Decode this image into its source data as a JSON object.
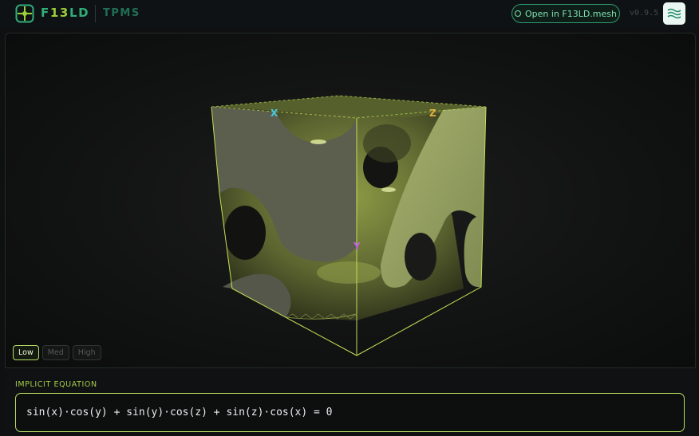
{
  "header": {
    "brand_prefix": "F",
    "brand_mid": "13",
    "brand_suffix": "LD",
    "product": "TPMS",
    "open_button_label": "Open in F13LD.mesh",
    "version": "v0.9.5",
    "icons": {
      "logo": "f13ld-logo-icon",
      "open": "ring-icon",
      "waves": "waves-icon"
    }
  },
  "viewer": {
    "axes": {
      "x": "X",
      "y": "Y",
      "z": "Z"
    },
    "quality_options": [
      "Low",
      "Med",
      "High"
    ],
    "quality_selected": "Low",
    "colors": {
      "surface": "#7f8c3f",
      "wireframe": "#c3df55",
      "background": "#121313"
    }
  },
  "equation": {
    "label": "IMPLICIT EQUATION",
    "text": "sin(x)·cos(y) + sin(y)·cos(z) + sin(z)·cos(x) = 0"
  },
  "colors": {
    "accent": "#b7dc62",
    "brand_green": "#2fae7a",
    "teal": "#7fe0b0"
  }
}
